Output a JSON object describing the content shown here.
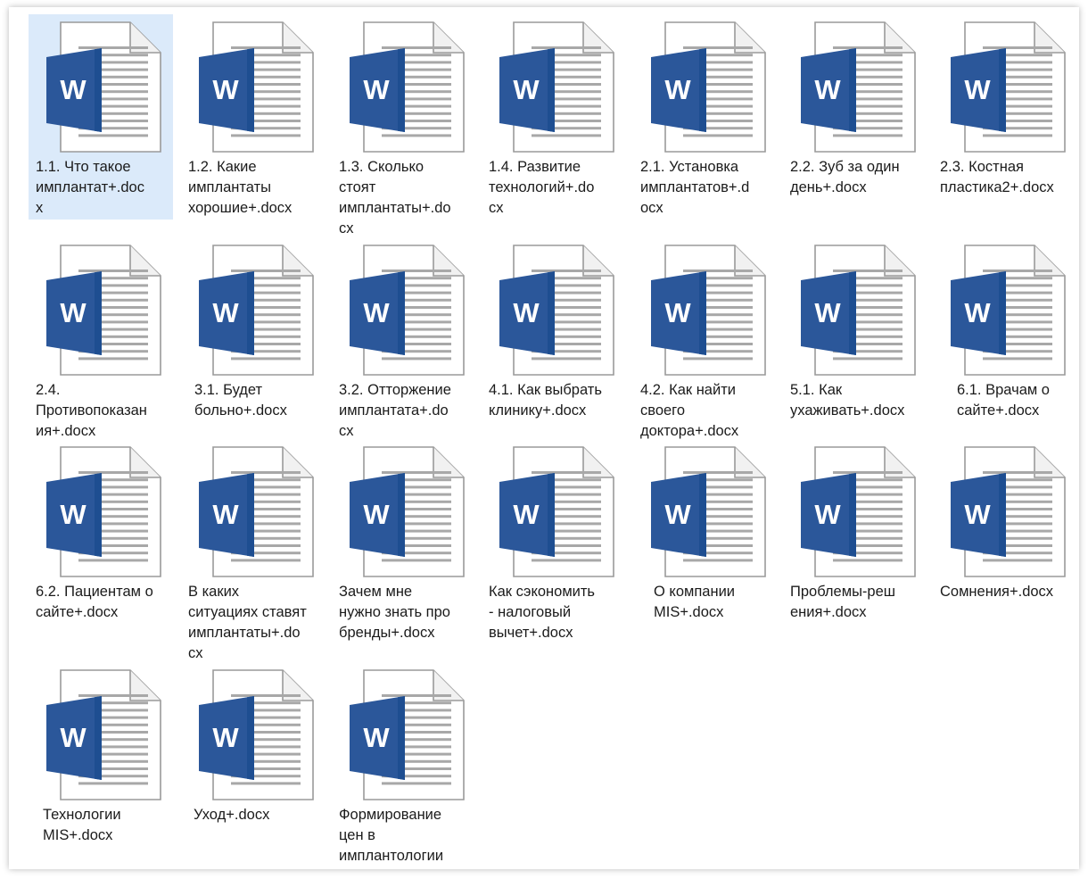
{
  "explorer": {
    "files": [
      {
        "name": "1.1. Что такое\nимплантат+.doc\nx",
        "icon": "word-document-icon",
        "selected": true
      },
      {
        "name": "1.2. Какие\nимплантаты\nхорошие+.docx",
        "icon": "word-document-icon"
      },
      {
        "name": "1.3. Сколько\nстоят\nимплантаты+.do\ncx",
        "icon": "word-document-icon"
      },
      {
        "name": "1.4. Развитие\nтехнологий+.do\ncx",
        "icon": "word-document-icon"
      },
      {
        "name": "2.1. Установка\nимплантатов+.d\nocx",
        "icon": "word-document-icon"
      },
      {
        "name": "2.2. Зуб за один\nдень+.docx",
        "icon": "word-document-icon"
      },
      {
        "name": "2.3. Костная\nпластика2+.docx",
        "icon": "word-document-icon"
      },
      {
        "name": "2.4.\nПротивопоказан\nия+.docx",
        "icon": "word-document-icon"
      },
      {
        "name": "3.1. Будет\nбольно+.docx",
        "icon": "word-document-icon"
      },
      {
        "name": "3.2. Отторжение\nимплантата+.do\ncx",
        "icon": "word-document-icon"
      },
      {
        "name": "4.1. Как выбрать\nклинику+.docx",
        "icon": "word-document-icon"
      },
      {
        "name": "4.2. Как найти\nсвоего\nдоктора+.docx",
        "icon": "word-document-icon"
      },
      {
        "name": "5.1. Как\nухаживать+.docx",
        "icon": "word-document-icon"
      },
      {
        "name": "6.1. Врачам о\nсайте+.docx",
        "icon": "word-document-icon"
      },
      {
        "name": "6.2. Пациентам о\nсайте+.docx",
        "icon": "word-document-icon"
      },
      {
        "name": "В каких\nситуациях ставят\nимплантаты+.do\ncx",
        "icon": "word-document-icon"
      },
      {
        "name": "Зачем мне\nнужно знать про\nбренды+.docx",
        "icon": "word-document-icon"
      },
      {
        "name": "Как сэкономить\n- налоговый\nвычет+.docx",
        "icon": "word-document-icon"
      },
      {
        "name": "О компании\nMIS+.docx",
        "icon": "word-document-icon"
      },
      {
        "name": "Проблемы-реш\nения+.docx",
        "icon": "word-document-icon"
      },
      {
        "name": "Сомнения+.docx",
        "icon": "word-document-icon"
      },
      {
        "name": "Технологии\nMIS+.docx",
        "icon": "word-document-icon"
      },
      {
        "name": "Уход+.docx",
        "icon": "word-document-icon"
      },
      {
        "name": "Формирование\nцен в\nимплантологии",
        "icon": "word-document-icon"
      }
    ]
  },
  "colors": {
    "selection": "#dbeafa",
    "word_blue": "#2b579a",
    "word_blue_dark": "#1e4e91",
    "page_lines": "#a8a8a8"
  },
  "icon_letter": "W"
}
